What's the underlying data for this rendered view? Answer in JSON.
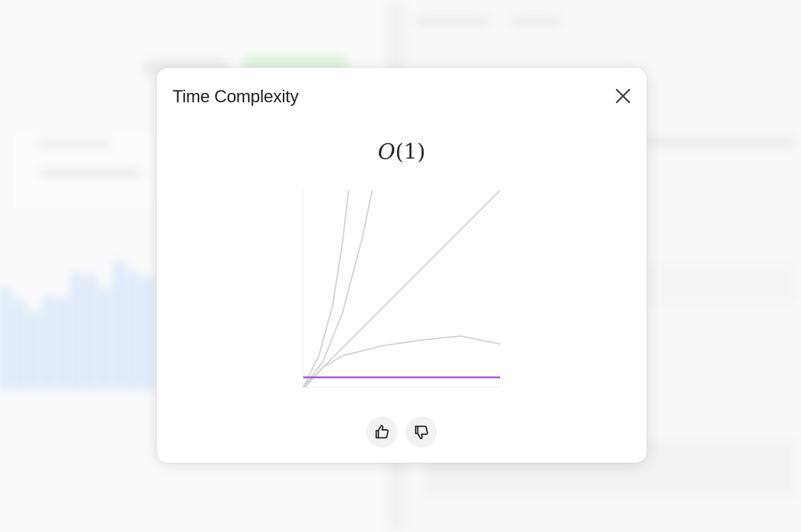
{
  "modal": {
    "title": "Time Complexity",
    "formula": {
      "func": "O",
      "arg": "1"
    }
  },
  "icons": {
    "close": "close-icon",
    "like": "thumbs-up-icon",
    "dislike": "thumbs-down-icon"
  },
  "chart_data": {
    "type": "line",
    "title": "",
    "xlabel": "",
    "ylabel": "",
    "grid": false,
    "legend": "none",
    "xlim": [
      0,
      10
    ],
    "ylim": [
      0,
      10
    ],
    "highlight_color": "#a14fd1",
    "muted_color": "#d4d4d4",
    "series": [
      {
        "key": "constant",
        "highlight": true,
        "x": [
          0,
          10
        ],
        "y": [
          0.5,
          0.5
        ]
      },
      {
        "key": "log",
        "highlight": false,
        "x": [
          0.1,
          1,
          2,
          4,
          6,
          8,
          10
        ],
        "y": [
          0,
          1.0,
          1.6,
          2.1,
          2.4,
          2.6,
          2.2
        ]
      },
      {
        "key": "linear",
        "highlight": false,
        "x": [
          0,
          10
        ],
        "y": [
          0,
          10
        ]
      },
      {
        "key": "quadratic",
        "highlight": false,
        "x": [
          0,
          1,
          2,
          3,
          3.5
        ],
        "y": [
          0,
          1.3,
          3.8,
          7.6,
          10
        ]
      },
      {
        "key": "exponential",
        "highlight": false,
        "x": [
          0,
          0.8,
          1.5,
          2,
          2.3
        ],
        "y": [
          0,
          1.6,
          4.2,
          7.4,
          10
        ]
      }
    ]
  }
}
